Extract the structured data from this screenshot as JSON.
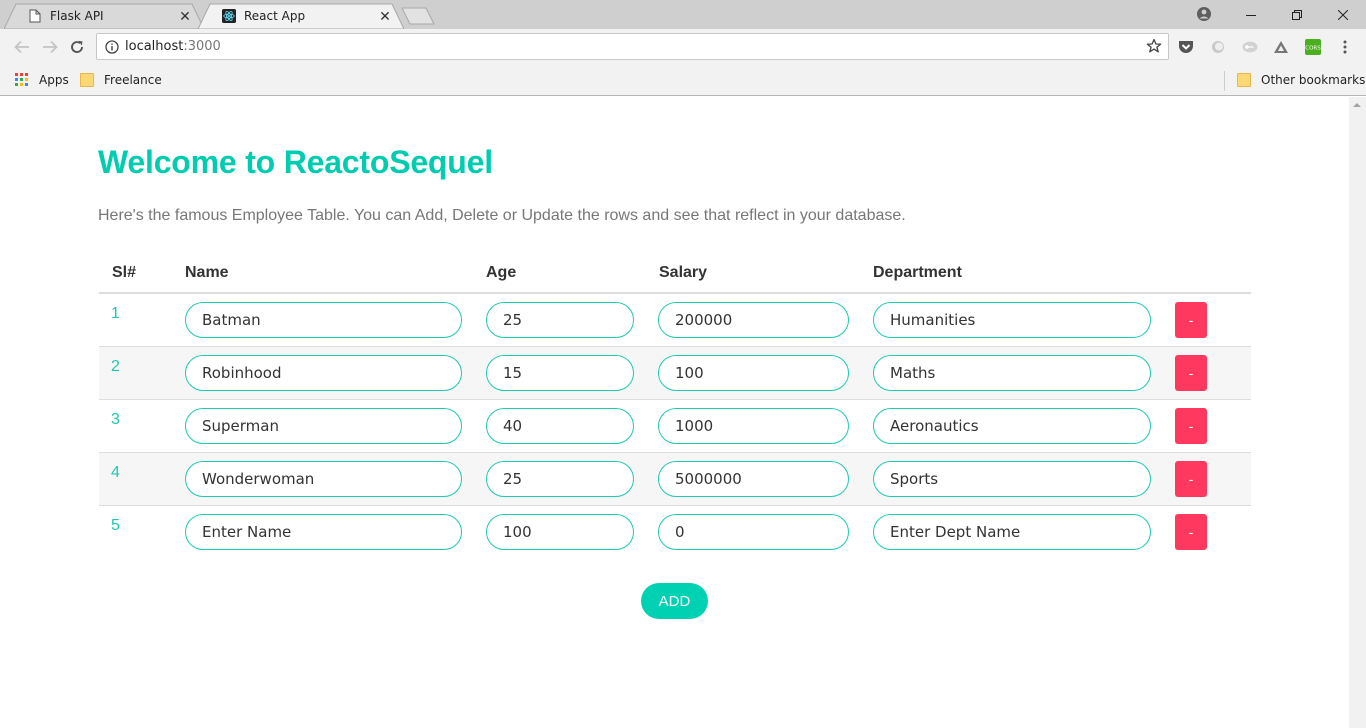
{
  "browser": {
    "tabs": [
      {
        "title": "Flask API",
        "icon": "document-icon",
        "active": false
      },
      {
        "title": "React App",
        "icon": "react-logo-icon",
        "active": true
      }
    ],
    "address": {
      "host": "localhost",
      "port": ":3000"
    },
    "bookmarks": [
      {
        "label": "Apps",
        "icon": "apps-grid-icon"
      },
      {
        "label": "Freelance",
        "icon": "folder-icon"
      }
    ],
    "other_bookmarks": "Other bookmarks",
    "extensions": [
      "pocket-icon",
      "circle-extension-icon",
      "key-extension-icon",
      "drive-icon",
      "cors-icon"
    ],
    "cors_label": "CORS"
  },
  "page": {
    "title": "Welcome to ReactoSequel",
    "subtitle": "Here's the famous Employee Table. You can Add, Delete or Update the rows and see that reflect in your database.",
    "columns": [
      "Sl#",
      "Name",
      "Age",
      "Salary",
      "Department"
    ],
    "rows": [
      {
        "sl": "1",
        "name": "Batman",
        "age": "25",
        "salary": "200000",
        "department": "Humanities"
      },
      {
        "sl": "2",
        "name": "Robinhood",
        "age": "15",
        "salary": "100",
        "department": "Maths"
      },
      {
        "sl": "3",
        "name": "Superman",
        "age": "40",
        "salary": "1000",
        "department": "Aeronautics"
      },
      {
        "sl": "4",
        "name": "Wonderwoman",
        "age": "25",
        "salary": "5000000",
        "department": "Sports"
      },
      {
        "sl": "5",
        "name": "Enter Name",
        "age": "100",
        "salary": "0",
        "department": "Enter Dept Name"
      }
    ],
    "delete_label": "-",
    "add_label": "ADD",
    "colors": {
      "accent": "#00d1b2",
      "danger": "#ff3860",
      "muted": "#777777"
    }
  }
}
